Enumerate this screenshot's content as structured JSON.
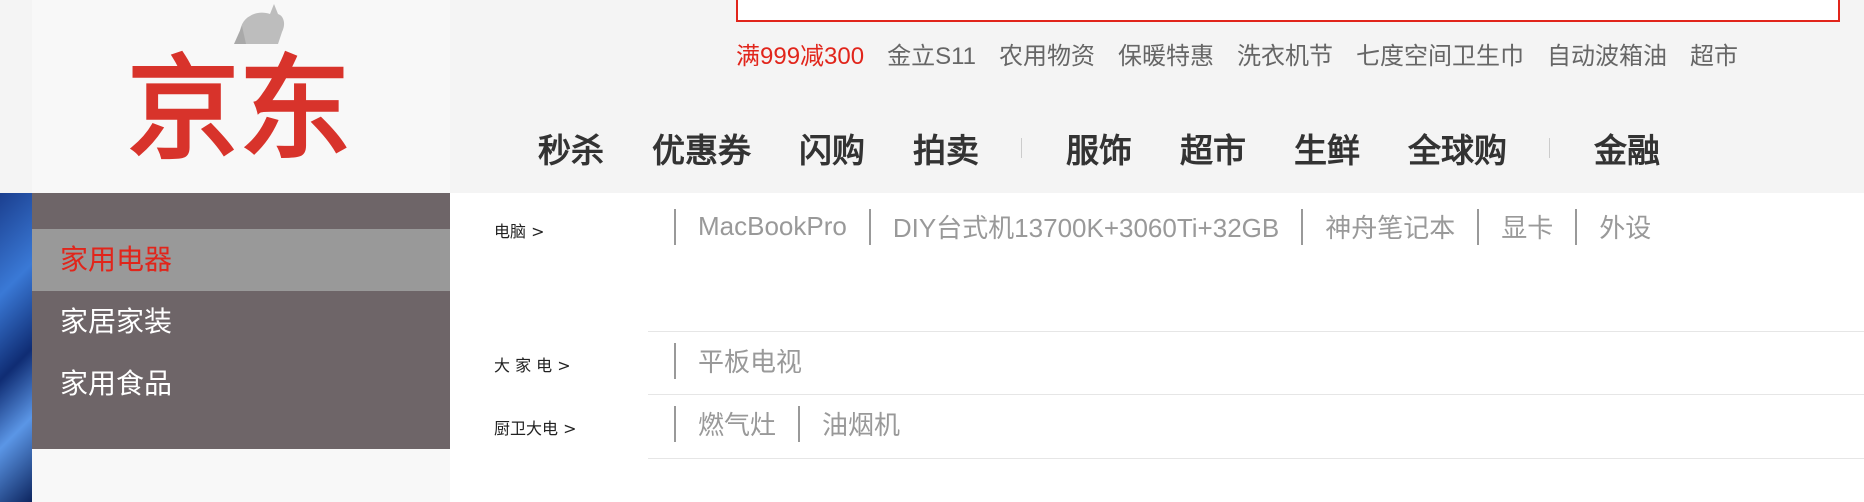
{
  "logo": {
    "text": "京东"
  },
  "hotwords": [
    {
      "label": "满999减300",
      "hot": true
    },
    {
      "label": "金立S11"
    },
    {
      "label": "农用物资"
    },
    {
      "label": "保暖特惠"
    },
    {
      "label": "洗衣机节"
    },
    {
      "label": "七度空间卫生巾"
    },
    {
      "label": "自动波箱油"
    },
    {
      "label": "超市"
    }
  ],
  "nav": [
    "秒杀",
    "优惠券",
    "闪购",
    "拍卖",
    "服饰",
    "超市",
    "生鲜",
    "全球购",
    "金融"
  ],
  "sidebar": {
    "items": [
      {
        "label": "家用电器",
        "active": true
      },
      {
        "label": "家居家装"
      },
      {
        "label": "家用食品"
      }
    ]
  },
  "categories": [
    {
      "title": "电脑 >",
      "links": [
        "MacBookPro",
        "DIY台式机13700K+3060Ti+32GB",
        "神舟笔记本",
        "显卡",
        "外设"
      ]
    },
    {
      "title": "大 家 电 >",
      "links": [
        "平板电视"
      ]
    },
    {
      "title": "厨卫大电 >",
      "links": [
        "燃气灶",
        "油烟机"
      ]
    }
  ],
  "colors": {
    "brand_red": "#e1251b",
    "sidebar_bg": "#6e6568",
    "sidebar_active_bg": "#999999"
  }
}
